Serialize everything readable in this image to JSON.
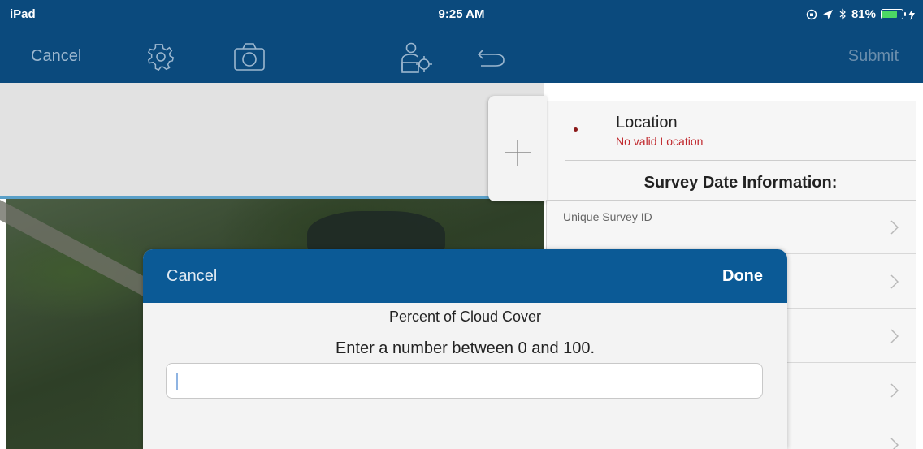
{
  "status_bar": {
    "device": "iPad",
    "time": "9:25 AM",
    "battery": "81%",
    "battery_level": 0.81
  },
  "nav_bar": {
    "cancel_label": "Cancel",
    "submit_label": "Submit",
    "icons": [
      "gear-icon",
      "camera-icon",
      "user-location-icon",
      "undo-icon"
    ]
  },
  "form": {
    "location": {
      "title": "Location",
      "error": "No valid Location"
    },
    "section_title": "Survey Date Information:",
    "fields": [
      {
        "label": "Unique Survey ID"
      },
      {
        "label": ""
      },
      {
        "label": ""
      },
      {
        "label": ""
      },
      {
        "label": ""
      }
    ]
  },
  "modal": {
    "cancel_label": "Cancel",
    "done_label": "Done",
    "title": "Percent of Cloud Cover",
    "hint": "Enter a number between 0 and 100.",
    "value": ""
  },
  "colors": {
    "header_blue": "#0b4a7d",
    "modal_header_blue": "#0b5a96",
    "error_red": "#c0282d"
  }
}
